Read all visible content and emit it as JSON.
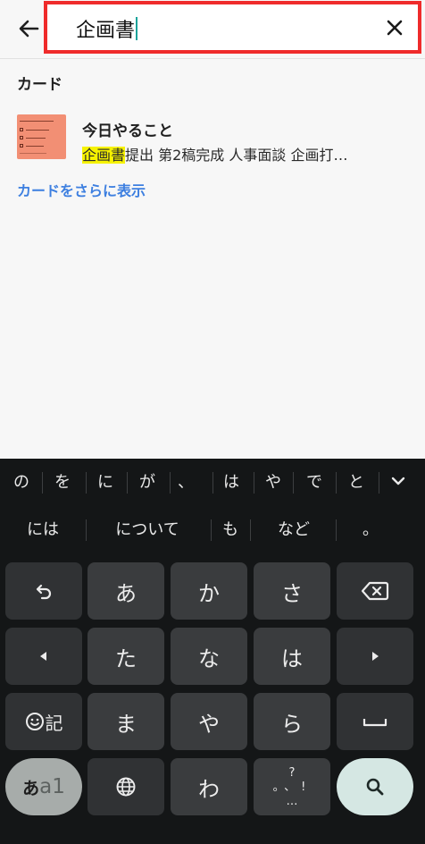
{
  "header": {
    "back_icon": "arrow-left-icon",
    "search_value": "企画書",
    "clear_icon": "close-icon",
    "search_border_color": "#ef2b2b"
  },
  "results": {
    "section_title": "カード",
    "card": {
      "title": "今日やること",
      "snippet_highlight": "企画書",
      "snippet_rest": "提出 第2稿完成 人事面談 企画打…",
      "thumbnail_color": "#f28f74"
    },
    "more_link": "カードをさらに表示",
    "link_color": "#3d7fe0",
    "highlight_color": "#f6f200"
  },
  "keyboard": {
    "suggestions_row1": [
      "の",
      "を",
      "に",
      "が",
      "、",
      "は",
      "や",
      "で",
      "と"
    ],
    "suggestions_row2": [
      "には",
      "について",
      "も",
      "など",
      "。"
    ],
    "expand_icon": "chevron-down-icon",
    "keys": {
      "undo_icon": "undo-icon",
      "a": "あ",
      "ka": "か",
      "sa": "さ",
      "backspace_icon": "backspace-icon",
      "left_icon": "left-triangle-icon",
      "ta": "た",
      "na": "な",
      "ha": "は",
      "right_icon": "right-triangle-icon",
      "emoji_label": "記",
      "ma": "ま",
      "ya": "や",
      "ra": "ら",
      "space_icon": "space-icon",
      "mode_kana": "あ",
      "mode_latin": "a1",
      "globe_icon": "globe-icon",
      "wa": "わ",
      "punct_top": "?",
      "punct_mid": "。、!",
      "punct_bottom": "…",
      "search_icon": "search-icon"
    }
  }
}
